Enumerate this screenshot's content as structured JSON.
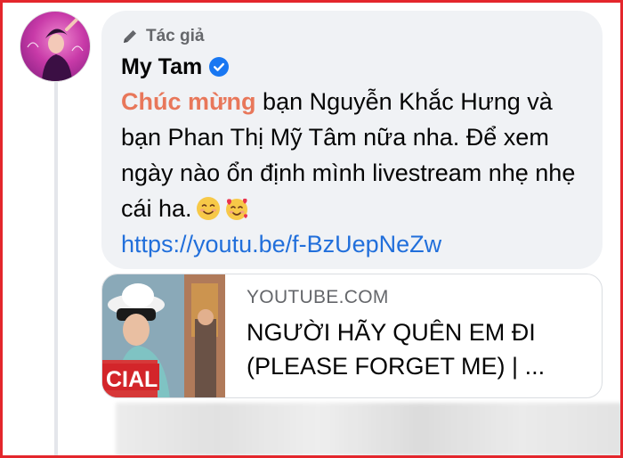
{
  "comment": {
    "badge_label": "Tác giả",
    "author_name": "My Tam",
    "mention": "Chúc mừng",
    "text_rest": " bạn Nguyễn Khắc Hưng và bạn Phan Thị Mỹ Tâm nữa nha. Để xem ngày nào ổn định mình livestream nhẹ nhẹ cái ha.",
    "emojis": [
      "smiling-face-emoji",
      "smiling-face-with-hearts-emoji"
    ],
    "link": "https://youtu.be/f-BzUepNeZw"
  },
  "preview": {
    "domain": "YOUTUBE.COM",
    "title": "NGƯỜI HÃY QUÊN EM ĐI (PLEASE FORGET ME) | ...",
    "thumb_label": "CIAL"
  },
  "colors": {
    "mention": "#e8775a",
    "link": "#216fdb",
    "verified": "#1877f2",
    "frame": "#e4262c"
  }
}
